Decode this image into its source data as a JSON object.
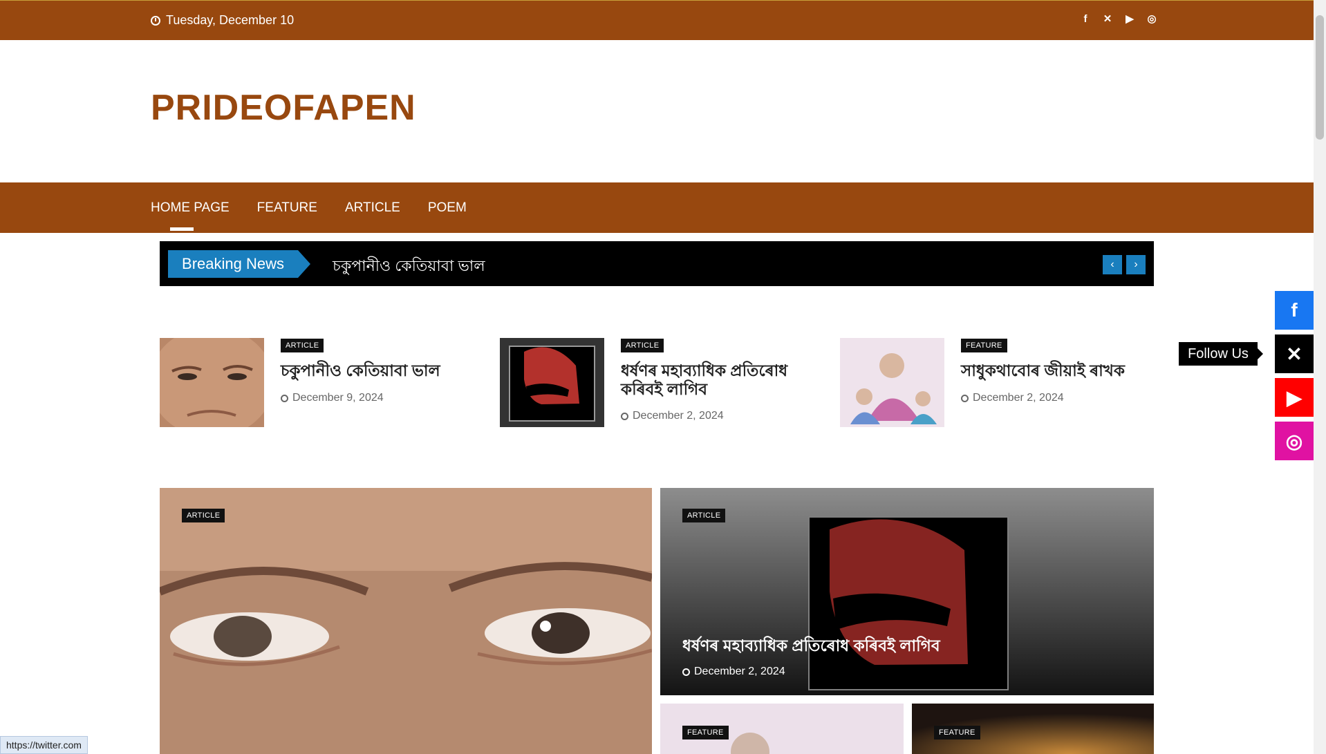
{
  "topbar": {
    "date": "Tuesday, December 10",
    "socials": [
      "facebook-icon",
      "x-icon",
      "youtube-icon",
      "instagram-icon"
    ]
  },
  "site": {
    "brand": "PRIDEOFAPEN"
  },
  "nav": {
    "items": [
      "HOME PAGE",
      "FEATURE",
      "ARTICLE",
      "POEM"
    ],
    "active": "HOME PAGE"
  },
  "ticker": {
    "label": "Breaking News",
    "headline": "চকুপানীও কেতিয়াবা ভাল"
  },
  "cards": [
    {
      "category": "ARTICLE",
      "title": "চকুপানীও কেতিয়াবা ভাল",
      "date": "December 9, 2024"
    },
    {
      "category": "ARTICLE",
      "title": "ধৰ্ষণৰ মহাব্যাধিক প্ৰতিৰোধ কৰিবই লাগিব",
      "date": "December 2, 2024"
    },
    {
      "category": "FEATURE",
      "title": "সাধুকথাবোৰ জীয়াই ৰাখক",
      "date": "December 2, 2024"
    }
  ],
  "featured": {
    "main": {
      "category": "ARTICLE"
    },
    "right": {
      "category": "ARTICLE",
      "title": "ধৰ্ষণৰ মহাব্যাধিক প্ৰতিৰোধ কৰিবই লাগিব",
      "date": "December 2, 2024"
    },
    "bottom_left": {
      "category": "FEATURE"
    },
    "bottom_right": {
      "category": "FEATURE"
    }
  },
  "follow": {
    "label": "Follow Us",
    "fb": "f",
    "tw": "✕",
    "yt": "▶",
    "ig": "◎"
  },
  "status": {
    "url": "https://twitter.com"
  },
  "colors": {
    "brand": "#98480f",
    "ticker_label": "#1a7fbe",
    "facebook": "#1877f2",
    "youtube": "#ff0000",
    "instagram": "#e012a2"
  }
}
